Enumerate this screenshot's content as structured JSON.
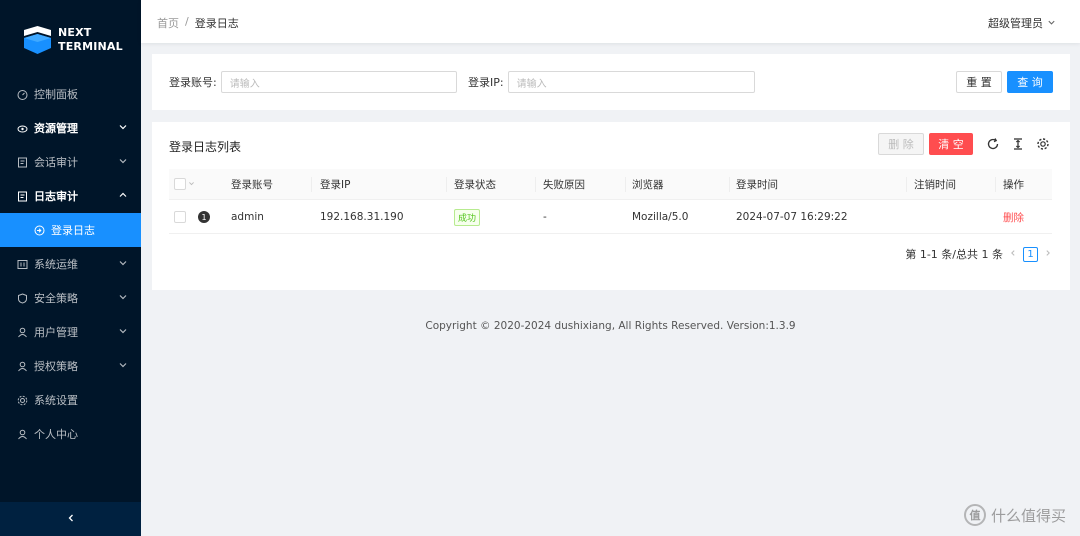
{
  "app": {
    "logo_line1": "NEXT",
    "logo_line2": "TERMINAL"
  },
  "sidebar": {
    "items": [
      {
        "label": "控制面板",
        "icon": "dashboard-icon"
      },
      {
        "label": "资源管理",
        "icon": "cloud-icon"
      },
      {
        "label": "会话审计",
        "icon": "audit-icon"
      },
      {
        "label": "日志审计",
        "icon": "log-icon"
      },
      {
        "label": "登录日志",
        "icon": "login-icon"
      },
      {
        "label": "系统运维",
        "icon": "ops-icon"
      },
      {
        "label": "安全策略",
        "icon": "shield-icon"
      },
      {
        "label": "用户管理",
        "icon": "user-icon"
      },
      {
        "label": "授权策略",
        "icon": "user-icon"
      },
      {
        "label": "系统设置",
        "icon": "gear-icon"
      },
      {
        "label": "个人中心",
        "icon": "user-icon"
      }
    ],
    "collapse_label": "‹"
  },
  "header": {
    "breadcrumb_home": "首页",
    "breadcrumb_sep": "/",
    "breadcrumb_current": "登录日志",
    "user": "超级管理员"
  },
  "search": {
    "account_label": "登录账号:",
    "account_placeholder": "请输入",
    "ip_label": "登录IP:",
    "ip_placeholder": "请输入",
    "reset_label": "重 置",
    "query_label": "查 询"
  },
  "table": {
    "title": "登录日志列表",
    "delete_label": "删 除",
    "clear_label": "清 空",
    "columns": [
      "登录账号",
      "登录IP",
      "登录状态",
      "失败原因",
      "浏览器",
      "登录时间",
      "注销时间",
      "操作"
    ],
    "rows": [
      {
        "index": "1",
        "account": "admin",
        "ip": "192.168.31.190",
        "status": "成功",
        "reason": "-",
        "browser": "Mozilla/5.0",
        "login_time": "2024-07-07 16:29:22",
        "logout_time": "",
        "action": "删除"
      }
    ],
    "pagination_summary": "第 1-1 条/总共 1 条",
    "current_page": "1"
  },
  "footer": {
    "copyright": "Copyright © 2020-2024 dushixiang, All Rights Reserved. Version:1.3.9"
  },
  "watermark": {
    "mark": "值",
    "text": "什么值得买"
  },
  "colors": {
    "sidebar_bg": "#001529",
    "primary": "#1890ff",
    "danger": "#ff4d4f",
    "success": "#52c41a"
  }
}
